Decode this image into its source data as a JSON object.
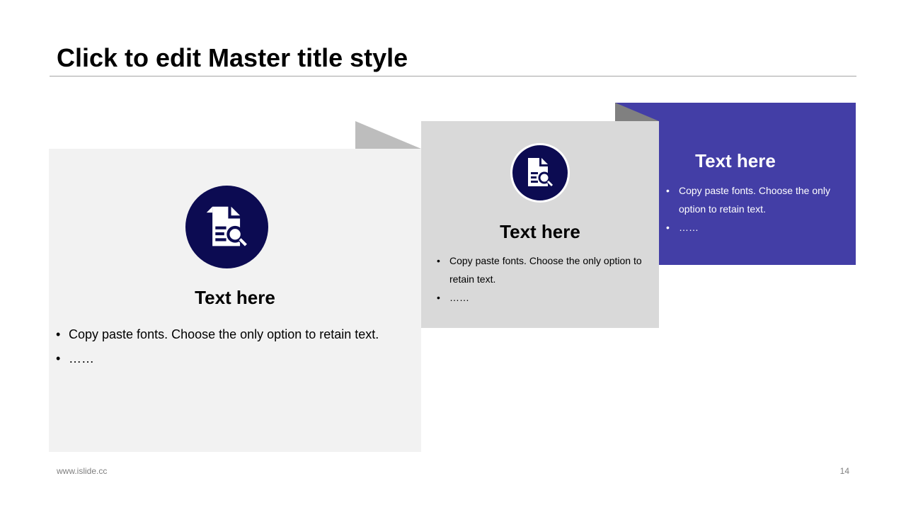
{
  "slide": {
    "title": "Click to edit Master title style",
    "footer_url": "www.islide.cc",
    "page_number": "14"
  },
  "panels": [
    {
      "heading": "Text here",
      "bullets": [
        "Copy paste fonts. Choose the only option to retain text.",
        "……"
      ],
      "icon": "document-search-icon",
      "background": "#f2f2f2"
    },
    {
      "heading": "Text here",
      "bullets": [
        "Copy paste fonts. Choose the only option to retain text.",
        "……"
      ],
      "icon": "document-search-icon",
      "background": "#d9d9d9"
    },
    {
      "heading": "Text here",
      "bullets": [
        "Copy paste fonts. Choose the only option to retain text.",
        "……"
      ],
      "background": "#433ea6"
    }
  ],
  "colors": {
    "icon_circle": "#0c0b52",
    "accent": "#433ea6",
    "fold_light": "#bdbdbd",
    "fold_dark": "#808080"
  }
}
